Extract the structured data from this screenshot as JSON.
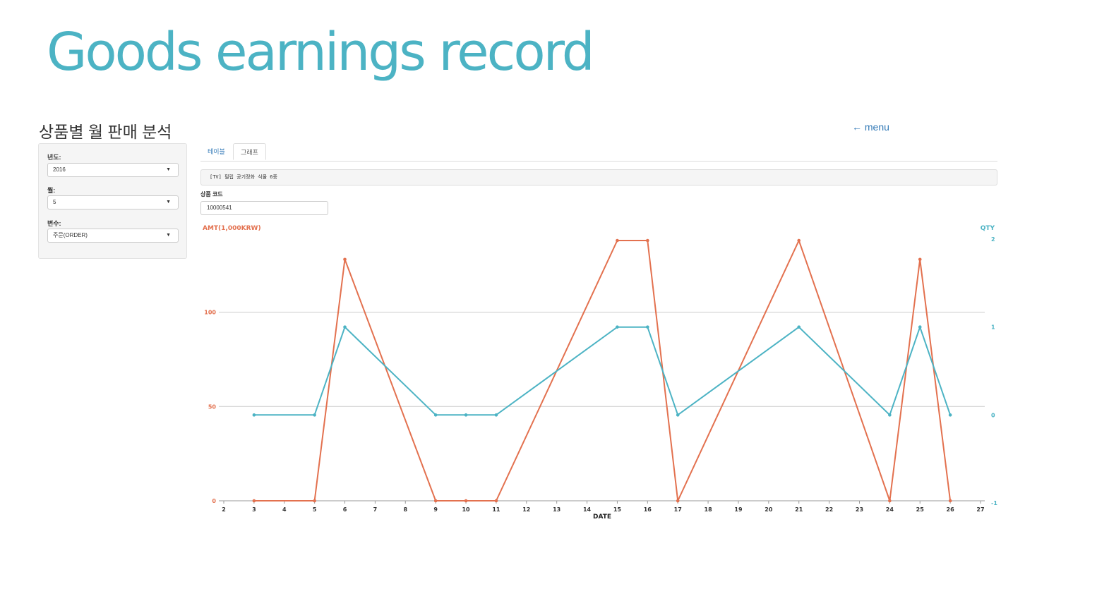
{
  "slide": {
    "title": "Goods earnings record"
  },
  "app": {
    "heading": "상품별 월 판매 분석",
    "menu_link": "← menu"
  },
  "sidebar": {
    "year": {
      "label": "년도:",
      "value": "2016"
    },
    "month": {
      "label": "월:",
      "value": "5"
    },
    "variable": {
      "label": "변수:",
      "value": "주문(ORDER)"
    }
  },
  "tabs": [
    {
      "label": "테이블",
      "active": false
    },
    {
      "label": "그래프",
      "active": true
    }
  ],
  "product": {
    "name_display": "[TV] 필립 공기정화 식물 6종",
    "code_label": "상품 코드",
    "code_value": "10000541"
  },
  "colors": {
    "amt": "#e3714f",
    "qty": "#4cb3c4",
    "title": "#4cb3c4",
    "link": "#337ab7"
  },
  "chart_data": {
    "type": "line",
    "xlabel": "DATE",
    "y_left_label": "AMT(1,000KRW)",
    "y_right_label": "QTY",
    "x_ticks": [
      2,
      3,
      4,
      5,
      6,
      7,
      8,
      9,
      10,
      11,
      12,
      13,
      14,
      15,
      16,
      17,
      18,
      19,
      20,
      21,
      22,
      23,
      24,
      25,
      26,
      27
    ],
    "x_range": [
      2,
      27
    ],
    "y_left_ticks": [
      0,
      50,
      100
    ],
    "y_left_range": [
      0,
      138
    ],
    "y_right_ticks": [
      -1,
      0,
      1,
      2
    ],
    "y_right_range": [
      -1,
      2
    ],
    "grid": "horizontal",
    "x": [
      3,
      5,
      6,
      9,
      10,
      11,
      15,
      16,
      17,
      21,
      24,
      25,
      26
    ],
    "series": [
      {
        "name": "AMT(1,000KRW)",
        "axis": "left",
        "values": [
          0,
          0,
          128,
          0,
          0,
          0,
          138,
          138,
          0,
          138,
          0,
          128,
          0
        ]
      },
      {
        "name": "QTY",
        "axis": "right",
        "values": [
          0,
          0,
          1,
          0,
          0,
          0,
          1,
          1,
          0,
          1,
          0,
          1,
          0
        ]
      }
    ]
  }
}
